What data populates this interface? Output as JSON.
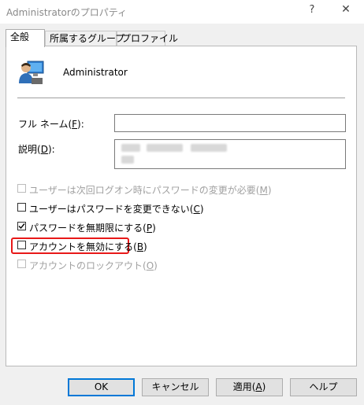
{
  "window": {
    "title": "Administratorのプロパティ",
    "help": "?",
    "close": "✕"
  },
  "tabs": [
    {
      "label": "全般"
    },
    {
      "label": "所属するグループ"
    },
    {
      "label": "プロファイル"
    }
  ],
  "user": {
    "name": "Administrator"
  },
  "fields": {
    "full_name": {
      "label_pre": "フル ネーム(",
      "key": "F",
      "label_post": "):",
      "value": ""
    },
    "description": {
      "label_pre": "説明(",
      "key": "D",
      "label_post": "):",
      "value": ""
    }
  },
  "options": [
    {
      "pre": "ユーザーは次回ログオン時にパスワードの変更が必要(",
      "key": "M",
      "post": ")",
      "checked": false,
      "disabled": true
    },
    {
      "pre": "ユーザーはパスワードを変更できない(",
      "key": "C",
      "post": ")",
      "checked": false,
      "disabled": false
    },
    {
      "pre": "パスワードを無期限にする(",
      "key": "P",
      "post": ")",
      "checked": true,
      "disabled": false
    },
    {
      "pre": "アカウントを無効にする(",
      "key": "B",
      "post": ")",
      "checked": false,
      "disabled": false
    },
    {
      "pre": "アカウントのロックアウト(",
      "key": "O",
      "post": ")",
      "checked": false,
      "disabled": true
    }
  ],
  "buttons": {
    "ok": {
      "label": "OK"
    },
    "cancel": {
      "label": "キャンセル"
    },
    "apply": {
      "pre": "適用(",
      "key": "A",
      "post": ")"
    },
    "help": {
      "label": "ヘルプ"
    }
  },
  "colors": {
    "accent": "#0078d7",
    "highlight": "#e81818",
    "disabled_text": "#a0a0a0"
  }
}
